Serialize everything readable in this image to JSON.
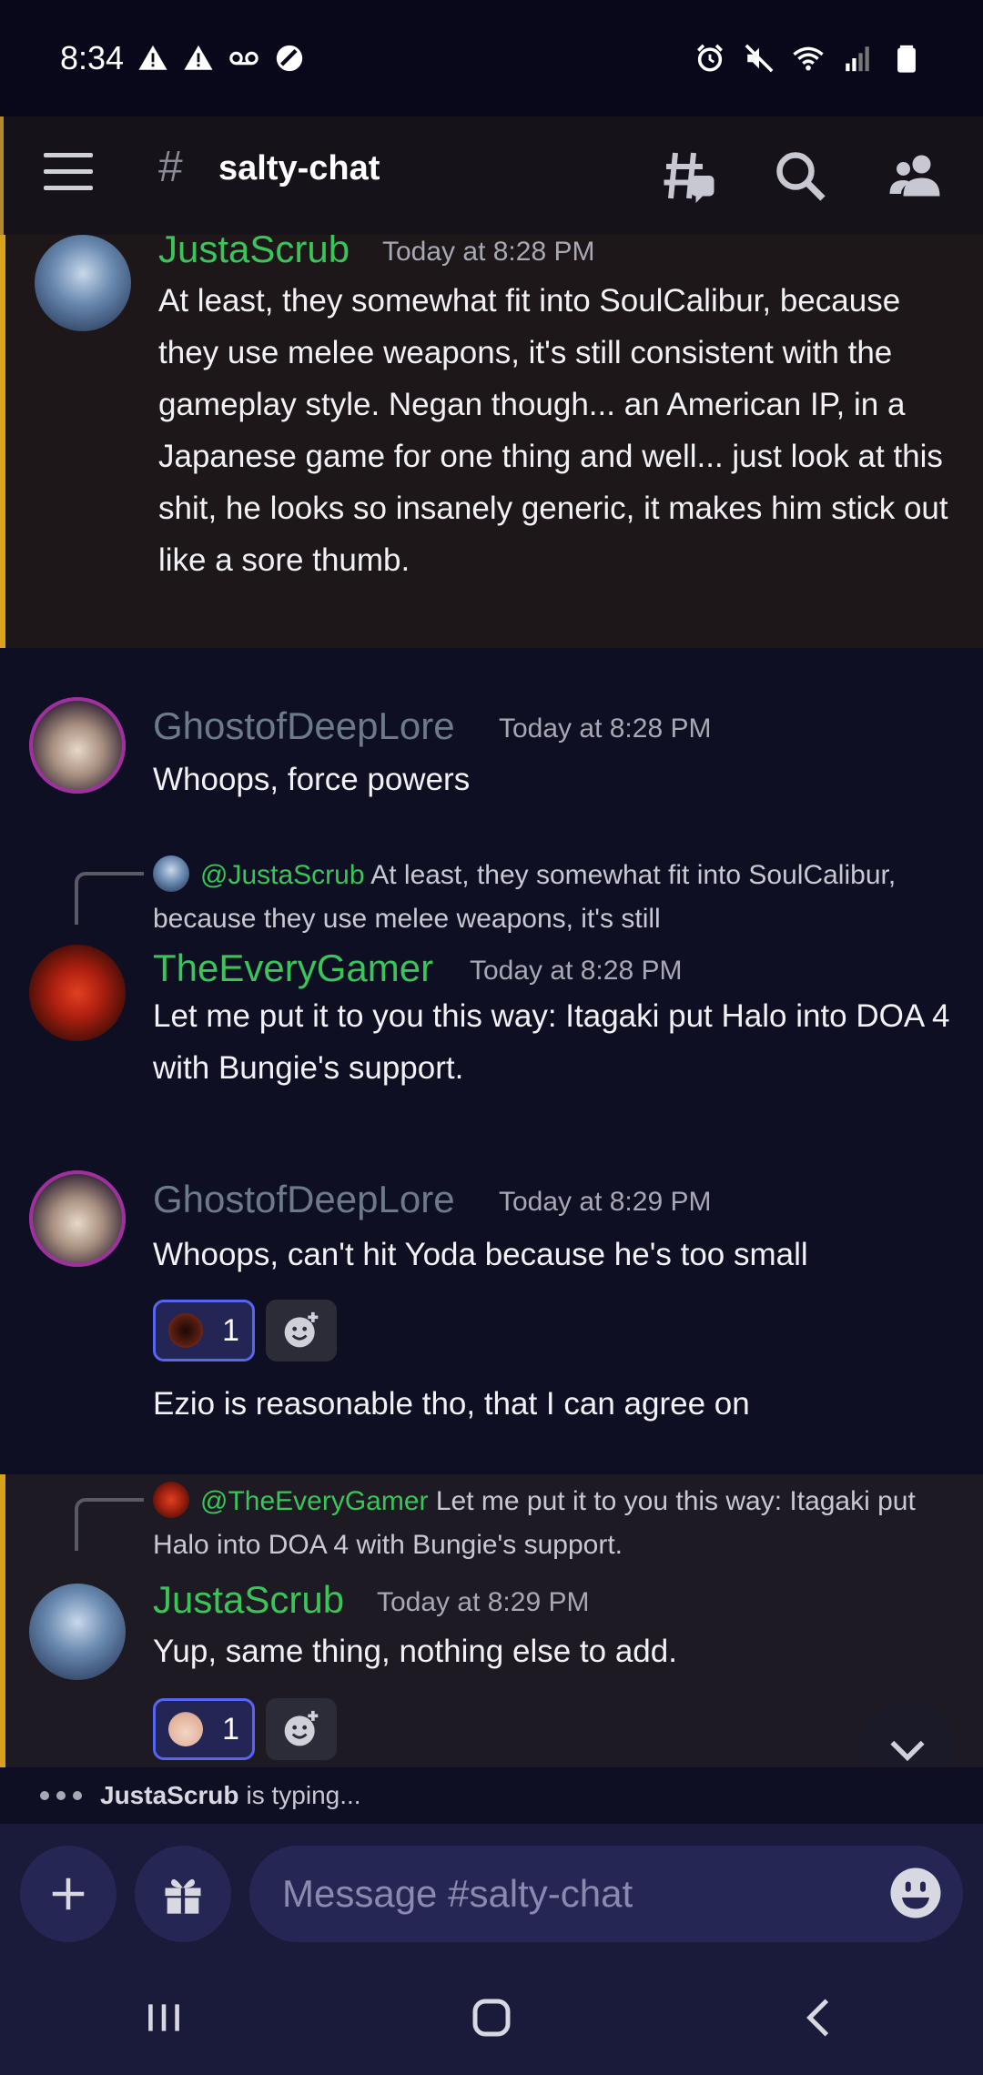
{
  "status_bar": {
    "time": "8:34",
    "icons_left": [
      "warning-icon",
      "warning-icon",
      "voicemail-icon",
      "no-entry-icon"
    ],
    "icons_right": [
      "alarm-icon",
      "mute-icon",
      "wifi-icon",
      "signal-icon",
      "battery-icon"
    ]
  },
  "header": {
    "hash": "#",
    "channel_name": "salty-chat",
    "icons": [
      "threads-icon",
      "search-icon",
      "members-icon"
    ]
  },
  "messages": [
    {
      "author": "JustaScrub",
      "timestamp": "Today at 8:28 PM",
      "text": "At least, they somewhat fit into SoulCalibur, because they use melee weapons, it's still consistent with the gameplay style. Negan though... an American IP, in a Japanese game for one thing and well... just look at this shit, he looks so insanely generic, it makes him stick out like a sore thumb."
    },
    {
      "author": "GhostofDeepLore",
      "timestamp": "Today at 8:28 PM",
      "text": "Whoops, force powers"
    },
    {
      "reply_user": "@JustaScrub",
      "reply_text": "At least, they somewhat fit into SoulCalibur, because they use melee weapons, it's still",
      "author": "TheEveryGamer",
      "timestamp": "Today at 8:28 PM",
      "text": "Let me put it to you this way: Itagaki put Halo into DOA 4 with Bungie's support."
    },
    {
      "author": "GhostofDeepLore",
      "timestamp": "Today at 8:29 PM",
      "text": "Whoops, can't hit Yoda because he's too small",
      "reaction_count": "1",
      "text2": "Ezio is reasonable tho, that I can agree on"
    },
    {
      "reply_user": "@TheEveryGamer",
      "reply_text": "Let me put it to you this way: Itagaki put Halo into DOA 4 with Bungie's support.",
      "author": "JustaScrub",
      "timestamp": "Today at 8:29 PM",
      "text": "Yup, same thing, nothing else to add.",
      "reaction_count": "1"
    }
  ],
  "typing": {
    "user": "JustaScrub",
    "suffix": "is typing..."
  },
  "composer": {
    "placeholder": "Message #salty-chat"
  },
  "colors": {
    "accent": "#5865f2",
    "green_name": "#3ac45a",
    "gray_name": "#6c7a8a",
    "mention_bar": "#d8a21a"
  }
}
